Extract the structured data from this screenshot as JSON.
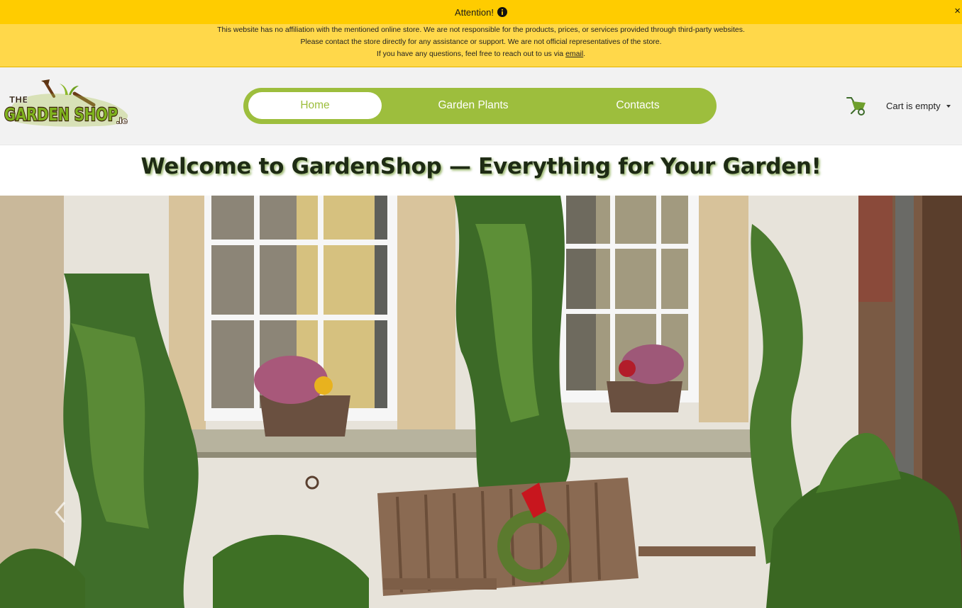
{
  "notice": {
    "title": "Attention!",
    "line1": "This website has no affiliation with the mentioned online store. We are not responsible for the products, prices, or services provided through third-party websites.",
    "line2": "Please contact the store directly for any assistance or support. We are not official representatives of the store.",
    "line3_prefix": "If you have any questions, feel free to reach out to us via ",
    "email_link": "email",
    "line3_suffix": ".",
    "close_label": "×"
  },
  "header": {
    "logo_text_top": "THE",
    "logo_text_main": "GARDEN SHOP",
    "logo_text_tld": ".ie",
    "nav": [
      {
        "label": "Home",
        "active": true
      },
      {
        "label": "Garden Plants",
        "active": false
      },
      {
        "label": "Contacts",
        "active": false
      }
    ],
    "cart_label": "Cart is empty"
  },
  "main": {
    "heading": "Welcome to GardenShop — Everything for Your Garden!"
  },
  "colors": {
    "banner": "#ffcc00",
    "nav_green": "#9dbe3d",
    "background": "#f2f2f2"
  },
  "icons": [
    "info-icon",
    "close-icon",
    "wheelbarrow-icon",
    "chevron-down-icon",
    "chevron-left-icon"
  ]
}
